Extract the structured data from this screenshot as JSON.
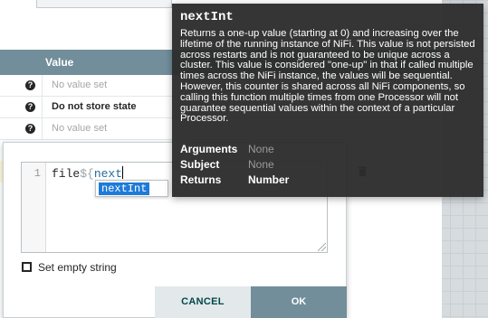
{
  "properties_table": {
    "value_header": "Value",
    "rows": [
      {
        "value": "No value set",
        "is_set": false
      },
      {
        "value": "Do not store state",
        "is_set": true
      },
      {
        "value": "No value set",
        "is_set": false
      }
    ],
    "help_glyph": "?"
  },
  "editor": {
    "line_number": "1",
    "code_prefix": "file",
    "code_delim": "${",
    "code_fn": "next",
    "autocomplete_item": "nextInt",
    "empty_string_label": "Set empty string",
    "cancel_label": "CANCEL",
    "ok_label": "OK"
  },
  "tooltip": {
    "title": "nextInt",
    "description": "Returns a one-up value (starting at 0) and increasing over the lifetime of the running instance of NiFi. This value is not persisted across restarts and is not guaranteed to be unique across a cluster. This value is considered \"one-up\" in that if called multiple times across the NiFi instance, the values will be sequential. However, this counter is shared across all NiFi components, so calling this function multiple times from one Processor will not guarantee sequential values within the context of a particular Processor.",
    "arguments_label": "Arguments",
    "arguments_value": "None",
    "subject_label": "Subject",
    "subject_value": "None",
    "returns_label": "Returns",
    "returns_value": "Number"
  },
  "colors": {
    "header": "#728e9b",
    "ok_button": "#728e9b",
    "cancel_button": "#e3e8eb",
    "autocomplete_highlight": "#1f7bd8",
    "tooltip_bg": "#2d2d2d"
  },
  "icons": {
    "help": "question-circle-icon",
    "delete": "trash-icon",
    "add": "plus-icon"
  }
}
